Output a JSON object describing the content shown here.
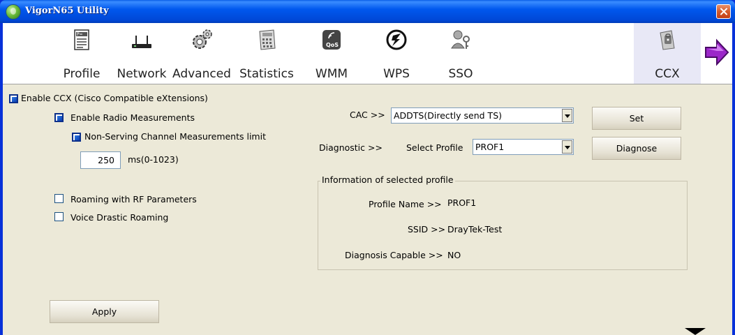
{
  "window": {
    "title": "VigorN65 Utility"
  },
  "toolbar": {
    "items": [
      {
        "label": "Profile",
        "icon": "profile-icon"
      },
      {
        "label": "Network",
        "icon": "network-icon"
      },
      {
        "label": "Advanced",
        "icon": "advanced-icon"
      },
      {
        "label": "Statistics",
        "icon": "statistics-icon"
      },
      {
        "label": "WMM",
        "icon": "wmm-icon",
        "badge": "QoS"
      },
      {
        "label": "WPS",
        "icon": "wps-icon"
      },
      {
        "label": "SSO",
        "icon": "sso-icon"
      },
      {
        "label": "CCX",
        "icon": "ccx-icon",
        "active": true
      }
    ],
    "next_icon": "next-arrow-icon"
  },
  "ccx": {
    "enable_ccx": {
      "label": "Enable CCX (Cisco Compatible eXtensions)",
      "checked": true
    },
    "enable_radio": {
      "label": "Enable Radio Measurements",
      "checked": true
    },
    "non_serving": {
      "label": "Non-Serving Channel Measurements limit",
      "checked": true
    },
    "limit_value": "250",
    "limit_unit": "ms(0-1023)",
    "roaming_rf": {
      "label": "Roaming with RF Parameters",
      "checked": false
    },
    "voice_roaming": {
      "label": "Voice Drastic Roaming",
      "checked": false
    },
    "apply_label": "Apply",
    "cac_label": "CAC >>",
    "cac_value": "ADDTS(Directly send TS)",
    "set_label": "Set",
    "diagnostic_label": "Diagnostic >>",
    "select_profile_label": "Select Profile",
    "select_profile_value": "PROF1",
    "diagnose_label": "Diagnose",
    "info": {
      "title": "Information of selected profile",
      "profile_name_label": "Profile Name >>",
      "profile_name_value": "PROF1",
      "ssid_label": "SSID >>",
      "ssid_value": "DrayTek-Test",
      "diag_capable_label": "Diagnosis Capable >>",
      "diag_capable_value": "NO"
    }
  },
  "colors": {
    "title_bar": "#0058EE",
    "panel_bg": "#ECE9D8",
    "active_tab": "#E8E8F6",
    "close_btn": "#D55A2B"
  }
}
